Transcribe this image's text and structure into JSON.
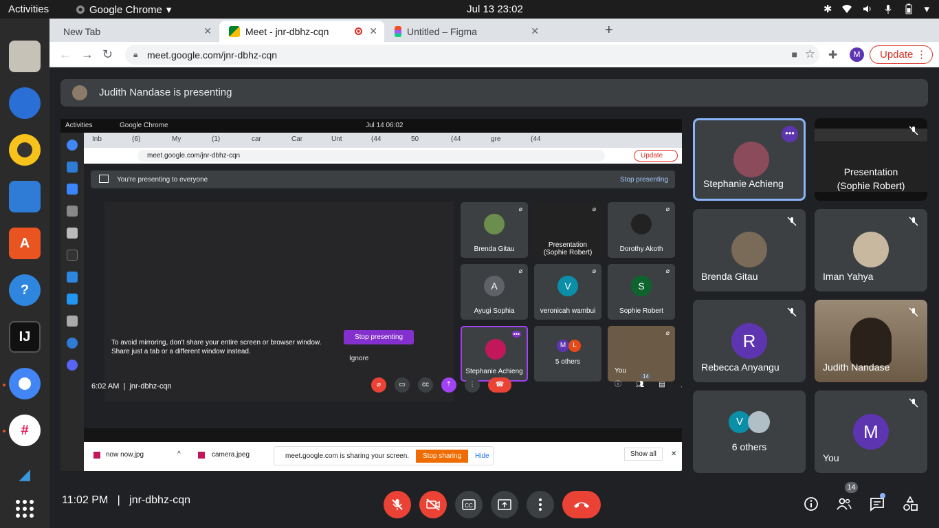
{
  "system_bar": {
    "activities": "Activities",
    "app_name": "Google Chrome",
    "datetime": "Jul 13  23:02"
  },
  "browser": {
    "tabs": [
      {
        "title": "New Tab"
      },
      {
        "title": "Meet - jnr-dbhz-cqn"
      },
      {
        "title": "Untitled – Figma"
      }
    ],
    "url": "meet.google.com/jnr-dbhz-cqn",
    "profile_initial": "M",
    "update_label": "Update"
  },
  "meet": {
    "presenting_banner": "Judith Nandase is presenting",
    "meeting_time": "11:02 PM",
    "meeting_code": "jnr-dbhz-cqn",
    "separator": "|",
    "participant_count": "14",
    "participants": [
      {
        "name": "Stephanie Achieng",
        "highlight": true
      },
      {
        "name": "Presentation\n(Sophie Robert)"
      },
      {
        "name": "Brenda Gitau"
      },
      {
        "name": "Iman Yahya"
      },
      {
        "name": "Rebecca Anyangu",
        "initial": "R",
        "color": "#5e35b1"
      },
      {
        "name": "Judith Nandase"
      },
      {
        "name": "6 others",
        "initials": [
          "V"
        ]
      },
      {
        "name": "You",
        "initial": "M",
        "color": "#5e35b1"
      }
    ]
  },
  "shared_screen": {
    "top_bar": {
      "activities": "Activities",
      "app_name": "Google Chrome",
      "datetime": "Jul 14  06:02"
    },
    "tabs": [
      "Inb",
      "(6)",
      "My",
      "(1)",
      "car",
      "Car",
      "Unt",
      "(44",
      "50",
      "(44",
      "gre",
      "(44"
    ],
    "url": "meet.google.com/jnr-dbhz-cqn",
    "update_label": "Update",
    "presenting_banner": "You're presenting to everyone",
    "stop_presenting": "Stop presenting",
    "tiles": [
      {
        "name": "Brenda Gitau"
      },
      {
        "name": "Presentation\n(Sophie Robert)"
      },
      {
        "name": "Dorothy Akoth"
      },
      {
        "name": "Ayugi Sophia",
        "initial": "A",
        "color": "#5f6368"
      },
      {
        "name": "veronicah wambui",
        "initial": "V",
        "color": "#0b8fa8"
      },
      {
        "name": "Sophie Robert",
        "initial": "S",
        "color": "#0d652d"
      },
      {
        "name": "Stephanie Achieng"
      },
      {
        "name": "5 others",
        "initials": [
          "M",
          "L"
        ]
      },
      {
        "name": "You"
      }
    ],
    "mirror_warning_1": "To avoid mirroring, don't share your entire screen or browser window.",
    "mirror_warning_2": "Share just a tab or a different window instead.",
    "stop_presenting_button": "Stop presenting",
    "ignore": "Ignore",
    "meeting_time": "6:02 AM",
    "meeting_code": "jnr-dbhz-cqn",
    "participant_count": "14",
    "downloads": [
      "now now.jpg",
      "camera.jpeg"
    ],
    "sharing_notice": "meet.google.com is sharing your screen.",
    "stop_sharing": "Stop sharing",
    "hide": "Hide",
    "show_all": "Show all"
  },
  "dock_apps": [
    "files-icon",
    "thunderbird-icon",
    "rhythmbox-icon",
    "writer-icon",
    "software-icon",
    "help-icon",
    "intellij-icon",
    "chrome-icon",
    "slack-icon",
    "vscode-icon",
    "apps-grid-icon"
  ]
}
